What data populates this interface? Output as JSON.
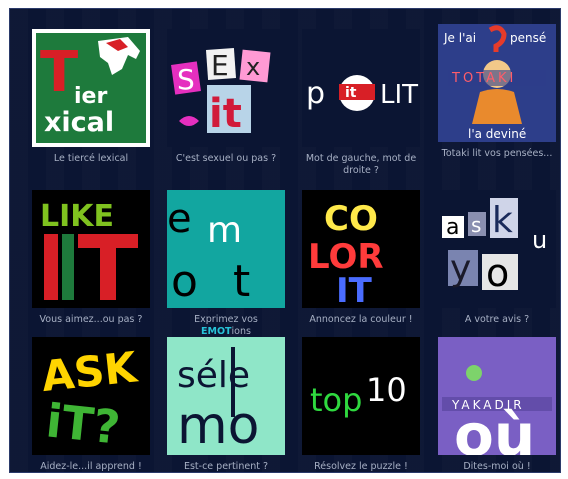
{
  "games": [
    {
      "id": "tierce",
      "caption": "Le tiercé lexical",
      "art": {
        "line1": "ier",
        "line2": "xical",
        "big": "T"
      }
    },
    {
      "id": "sexit",
      "caption": "C'est sexuel ou pas ?",
      "art": {
        "l1": "S",
        "l2": "E",
        "l3": "x",
        "l4": "it"
      }
    },
    {
      "id": "politlit",
      "caption": "Mot de gauche, mot de droite ?",
      "art": {
        "p": "p",
        "o": "o",
        "it": "it",
        "lit": "LIT"
      }
    },
    {
      "id": "totaki",
      "caption": "Totaki lit vos pensées...",
      "art": {
        "top": "Je l'ai",
        "top2": "pensé",
        "name": "TOTAKI",
        "bottom": "l'a deviné"
      }
    },
    {
      "id": "likeit",
      "caption": "Vous aimez...ou pas ?",
      "art": {
        "like": "LIKE",
        "it": "IT"
      }
    },
    {
      "id": "emotion",
      "caption_before": "Exprimez vos",
      "caption_hl": "EMOT",
      "caption_after": "ions",
      "art": {
        "l1": "e",
        "l2": "m",
        "l3": "o",
        "l4": "t"
      }
    },
    {
      "id": "colorit",
      "caption": "Annoncez la couleur !",
      "art": {
        "l1": "CO",
        "l2": "LOR",
        "l3": "IT"
      }
    },
    {
      "id": "askyou",
      "caption": "A votre avis ?",
      "art": {
        "a": "a",
        "s": "s",
        "k": "k",
        "u": "u",
        "y": "y",
        "o": "o"
      }
    },
    {
      "id": "askit",
      "caption": "Aidez-le...il apprend !",
      "art": {
        "l1": "ASK",
        "l2": "iT?"
      }
    },
    {
      "id": "selemo",
      "caption": "Est-ce pertinent ?",
      "art": {
        "l1": "séle",
        "l2": "mo"
      }
    },
    {
      "id": "top10",
      "caption": "Résolvez le puzzle !",
      "art": {
        "top": "top",
        "ten": "10"
      }
    },
    {
      "id": "yakadir",
      "caption": "Dites-moi où !",
      "art": {
        "name": "YAKADIR",
        "word": "où"
      }
    }
  ]
}
